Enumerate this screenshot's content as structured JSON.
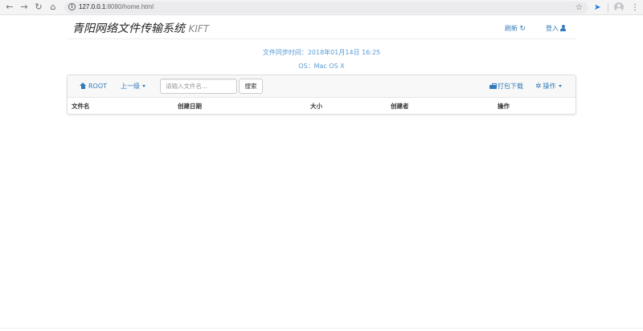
{
  "browser": {
    "back": "←",
    "forward": "→",
    "reload": "↻",
    "home": "⌂",
    "url_host": "127.0.0.1",
    "url_rest": ":8080/home.html",
    "bookmark_star": "☆",
    "menu": "⋮",
    "extension_glyph": "➤"
  },
  "header": {
    "brand": "青阳网络文件传输系统",
    "brand_suffix": "KIFT",
    "refresh_label": "刷新",
    "login_label": "登入"
  },
  "info": {
    "sync_time": "文件同步时间：2018年01月14日 16:25",
    "os": "OS：Mac OS X"
  },
  "toolbar": {
    "root_label": "ROOT",
    "up_label": "上一级",
    "search_placeholder": "请输入文件名...",
    "search_button": "搜索",
    "download_label": "打包下载",
    "actions_label": "操作"
  },
  "table": {
    "columns": [
      "文件名",
      "创建日期",
      "大小",
      "创建者",
      "操作"
    ]
  },
  "colors": {
    "link": "#337ab7",
    "info_text": "#5b9bd5",
    "toolbar_bg": "#f8f8f8"
  }
}
